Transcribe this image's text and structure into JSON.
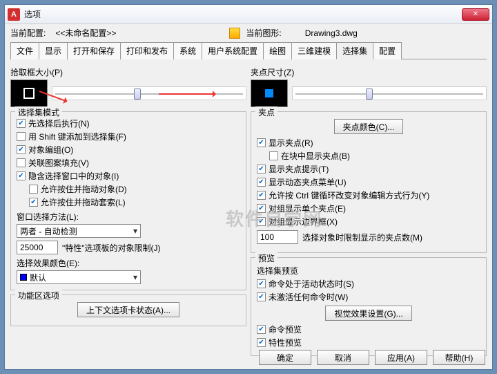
{
  "window": {
    "title": "选项",
    "icon": "A"
  },
  "info": {
    "profile_label": "当前配置:",
    "profile_value": "<<未命名配置>>",
    "drawing_label": "当前图形:",
    "drawing_value": "Drawing3.dwg"
  },
  "tabs": [
    "文件",
    "显示",
    "打开和保存",
    "打印和发布",
    "系统",
    "用户系统配置",
    "绘图",
    "三维建模",
    "选择集",
    "配置"
  ],
  "active_tab": 8,
  "left": {
    "pickbox_label": "拾取框大小(P)",
    "mode_title": "选择集模式",
    "modes": [
      {
        "k": "noun_verb",
        "label": "先选择后执行(N)",
        "on": true,
        "indent": false
      },
      {
        "k": "shift_add",
        "label": "用 Shift 键添加到选择集(F)",
        "on": false,
        "indent": false
      },
      {
        "k": "obj_group",
        "label": "对象编组(O)",
        "on": true,
        "indent": false
      },
      {
        "k": "hatch_assoc",
        "label": "关联图案填充(V)",
        "on": false,
        "indent": false
      },
      {
        "k": "implied_window",
        "label": "隐含选择窗口中的对象(I)",
        "on": true,
        "indent": false
      },
      {
        "k": "press_drag",
        "label": "允许按住并拖动对象(D)",
        "on": false,
        "indent": true
      },
      {
        "k": "press_drag_lasso",
        "label": "允许按住并拖动套索(L)",
        "on": true,
        "indent": true
      }
    ],
    "window_method_label": "窗口选择方法(L):",
    "window_method_value": "两者 - 自动检测",
    "prop_limit_value": "25000",
    "prop_limit_label": "\"特性\"选项板的对象限制(J)",
    "effect_color_label": "选择效果颜色(E):",
    "effect_color_value": "默认",
    "ribbon_title": "功能区选项",
    "ribbon_btn": "上下文选项卡状态(A)..."
  },
  "right": {
    "grip_size_label": "夹点尺寸(Z)",
    "grips_title": "夹点",
    "grip_color_btn": "夹点颜色(C)...",
    "grip_checks": [
      {
        "k": "show_grips",
        "label": "显示夹点(R)",
        "on": true,
        "indent": false
      },
      {
        "k": "grips_in_block",
        "label": "在块中显示夹点(B)",
        "on": false,
        "indent": true
      },
      {
        "k": "grip_tips",
        "label": "显示夹点提示(T)",
        "on": true,
        "indent": false
      },
      {
        "k": "dyn_grip_menu",
        "label": "显示动态夹点菜单(U)",
        "on": true,
        "indent": false
      },
      {
        "k": "ctrl_cycle",
        "label": "允许按 Ctrl 键循环改变对象编辑方式行为(Y)",
        "on": true,
        "indent": false
      },
      {
        "k": "group_single",
        "label": "对组显示单个夹点(E)",
        "on": true,
        "indent": false
      },
      {
        "k": "group_bbox",
        "label": "对组显示边界框(X)",
        "on": true,
        "indent": false
      }
    ],
    "grip_limit_value": "100",
    "grip_limit_label": "选择对象时限制显示的夹点数(M)",
    "preview_title": "预览",
    "preview_sub": "选择集预览",
    "preview_checks": [
      {
        "k": "cmd_active",
        "label": "命令处于活动状态时(S)",
        "on": true
      },
      {
        "k": "no_active_cmd",
        "label": "未激活任何命令时(W)",
        "on": true
      }
    ],
    "visual_btn": "视觉效果设置(G)...",
    "extra_checks": [
      {
        "k": "cmd_preview",
        "label": "命令预览",
        "on": true
      },
      {
        "k": "prop_preview",
        "label": "特性预览",
        "on": true
      }
    ]
  },
  "footer": {
    "ok": "确定",
    "cancel": "取消",
    "apply": "应用(A)",
    "help": "帮助(H)"
  },
  "watermark": "软件自学网"
}
